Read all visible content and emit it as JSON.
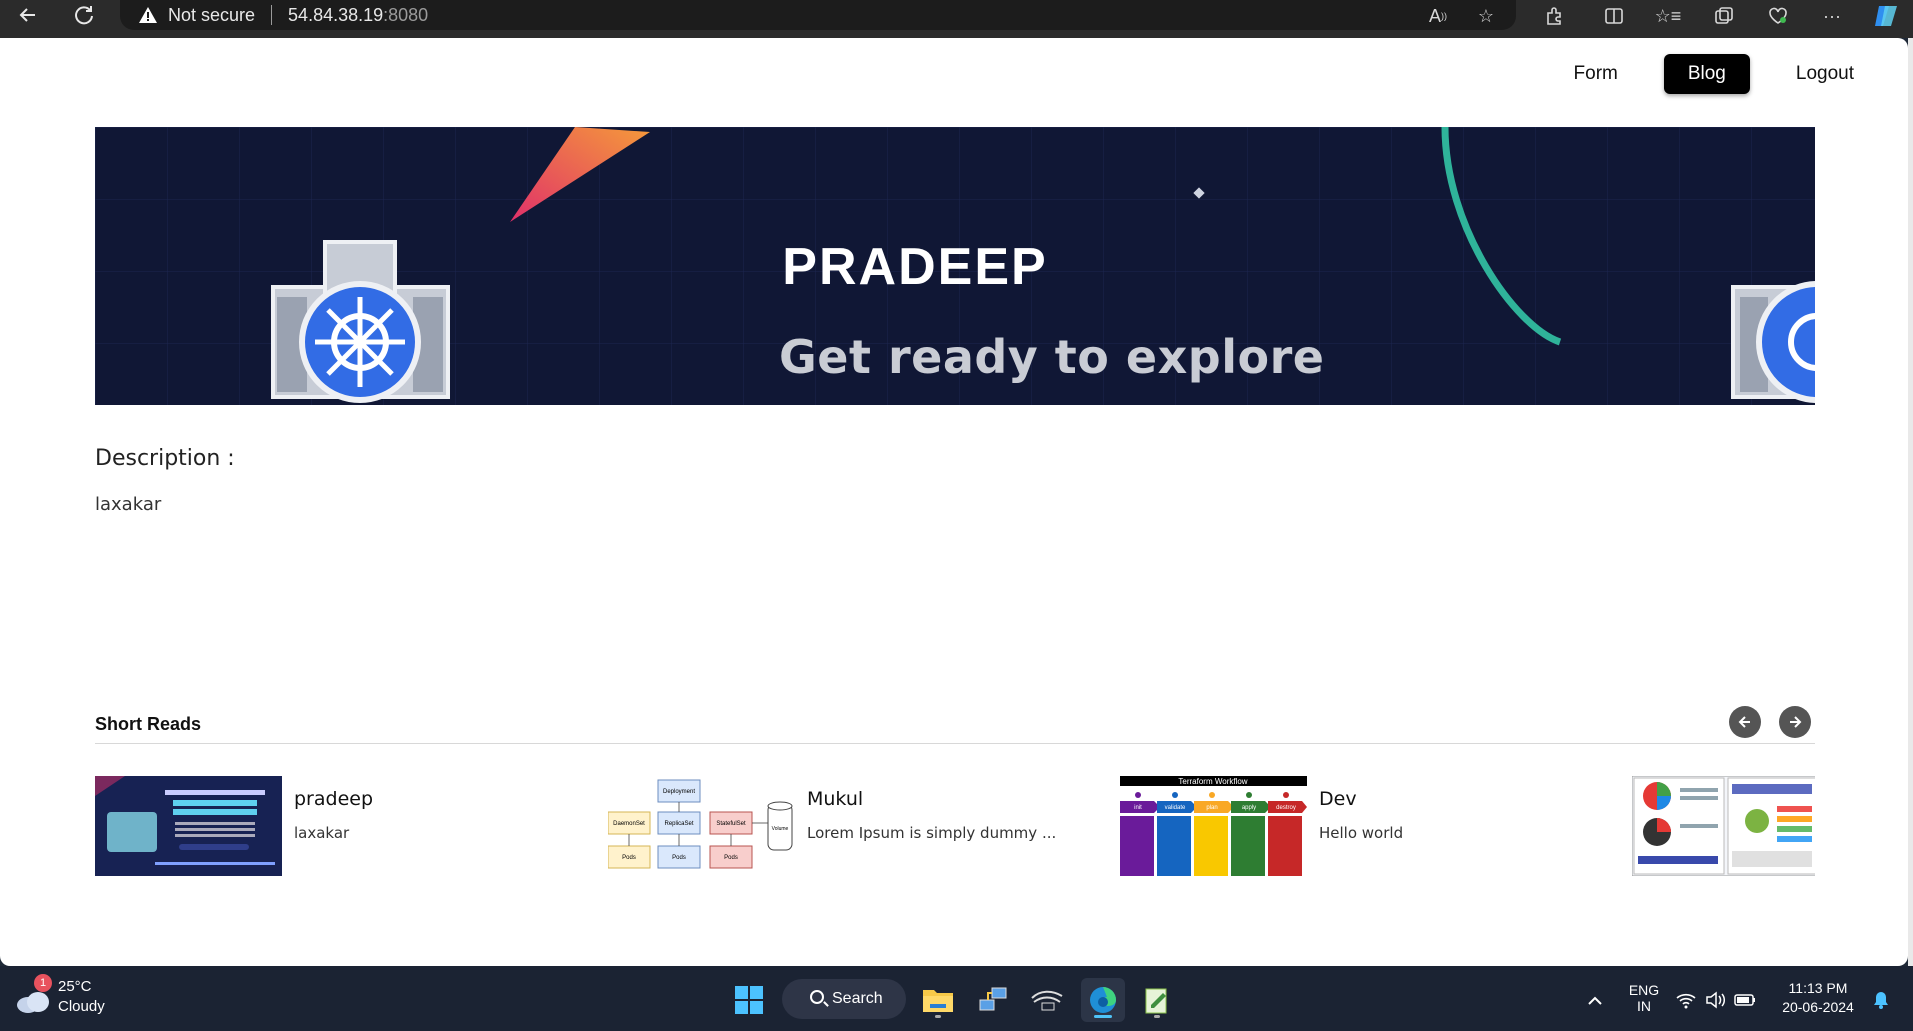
{
  "browser": {
    "security_label": "Not secure",
    "url_host": "54.84.38.19",
    "url_port": ":8080"
  },
  "nav": {
    "items": [
      "Form",
      "Blog",
      "Logout"
    ],
    "active": "Blog"
  },
  "hero": {
    "title": "PRADEEP",
    "subtitle": "Get ready to explore"
  },
  "description": {
    "label": "Description :",
    "text": "laxakar"
  },
  "short_reads": {
    "title": "Short Reads",
    "cards": [
      {
        "title": "pradeep",
        "desc": "laxakar"
      },
      {
        "title": "Mukul",
        "desc": "Lorem Ipsum is simply dummy ..."
      },
      {
        "title": "Dev",
        "desc": "Hello world"
      }
    ],
    "thumb_texts": {
      "mukul_diagram": [
        "Deployment",
        "DaemonSet",
        "ReplicaSet",
        "StatefulSet",
        "Volume",
        "Pods",
        "Pods",
        "Pods"
      ],
      "dev_workflow": {
        "title": "Terraform Workflow",
        "steps": [
          "init",
          "validate",
          "plan",
          "apply",
          "destroy"
        ]
      }
    }
  },
  "taskbar": {
    "weather_temp": "25°C",
    "weather_cond": "Cloudy",
    "weather_badge": "1",
    "search_label": "Search",
    "lang_line1": "ENG",
    "lang_line2": "IN",
    "time": "11:13 PM",
    "date": "20-06-2024"
  },
  "colors": {
    "hero_bg": "#101735",
    "nav_active_bg": "#000000",
    "taskbar_bg": "#1b2333"
  }
}
